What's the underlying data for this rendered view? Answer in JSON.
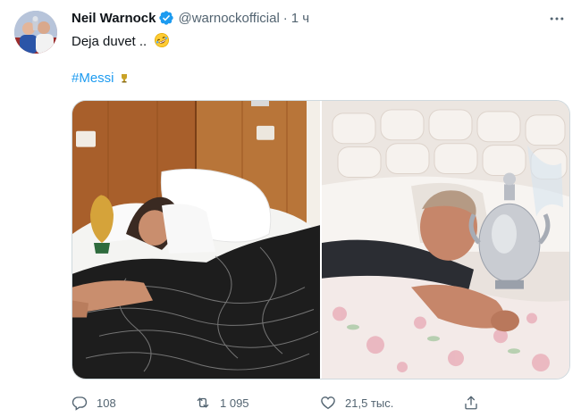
{
  "tweet": {
    "author_name": "Neil Warnock",
    "author_handle": "@warnockofficial",
    "separator": "·",
    "timestamp": "1 ч",
    "text": "Deja duvet ..",
    "text_emoji": "rolling-on-floor-laughing-emoji",
    "hashtag": "#Messi",
    "hashtag_emoji": "trophy-emoji"
  },
  "media": {
    "left_image": "messi-sleeping-with-world-cup-trophy",
    "right_image": "warnock-sleeping-with-championship-trophy"
  },
  "actions": {
    "reply_count": "108",
    "retweet_count": "1 095",
    "like_count": "21,5 тыс."
  },
  "icons": {
    "verified": "verified-badge-icon",
    "more": "more-icon",
    "reply": "reply-icon",
    "retweet": "retweet-icon",
    "like": "like-icon",
    "share": "share-icon"
  },
  "colors": {
    "link": "#1d9bf0",
    "secondary_text": "#536471",
    "border": "#cfd9de"
  }
}
